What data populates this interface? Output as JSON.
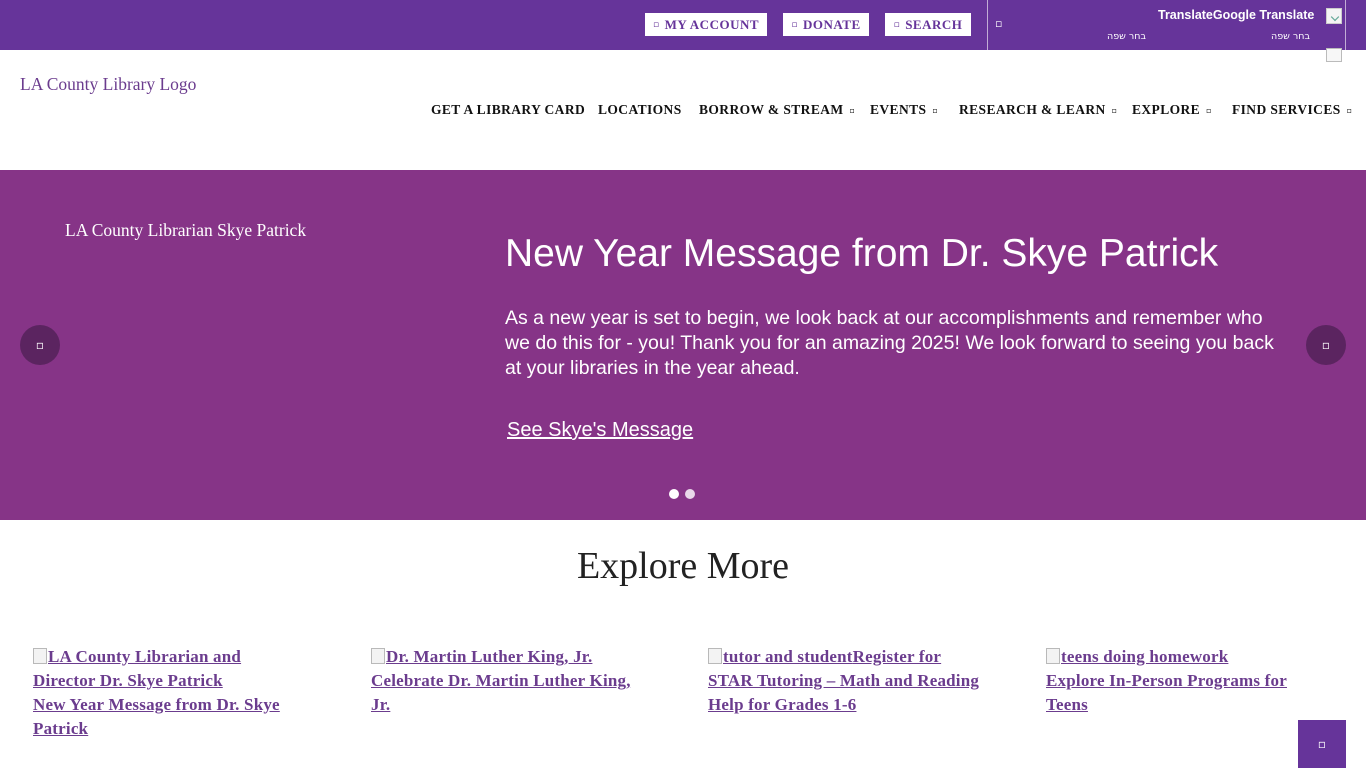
{
  "topbar": {
    "my_account": "MY ACCOUNT",
    "donate": "DONATE",
    "search": "SEARCH",
    "translate_label": "TranslateGoogle Translate",
    "lang_select_1": "בחר שפה",
    "lang_select_2": "בחר שפה",
    "bg_color": "#66349a"
  },
  "header": {
    "logo_alt": "LA County Library Logo",
    "nav": [
      {
        "label": "GET A LIBRARY CARD"
      },
      {
        "label": "LOCATIONS"
      },
      {
        "label": "BORROW & STREAM"
      },
      {
        "label": "EVENTS"
      },
      {
        "label": "RESEARCH & LEARN"
      },
      {
        "label": "EXPLORE"
      },
      {
        "label": "FIND SERVICES"
      }
    ]
  },
  "hero": {
    "image_alt": "LA County Librarian Skye Patrick",
    "title": "New Year Message from Dr. Skye Patrick",
    "body": "As a new year is set to begin, we look back at our accomplishments and remember who we do this for - you! Thank you for an amazing 2025! We look forward to seeing you back at your libraries in the year ahead.",
    "link": "See Skye's Message",
    "bg_color": "#863487",
    "slide_count": 2,
    "active_slide": 1
  },
  "explore": {
    "title": "Explore More",
    "cards": [
      {
        "img_alt": "LA County Librarian and Director Dr. Skye Patrick",
        "caption": "New Year Message from Dr. Skye Patrick"
      },
      {
        "img_alt": "Dr. Martin Luther King, Jr.",
        "caption": "Celebrate Dr. Martin Luther King, Jr."
      },
      {
        "img_alt": "tutor and student",
        "caption": "Register for STAR Tutoring – Math and Reading Help for Grades 1-6"
      },
      {
        "img_alt": "teens doing homework",
        "caption": "Explore In-Person Programs for Teens"
      }
    ]
  },
  "icons": {
    "account": "user-icon",
    "donate": "heart-icon",
    "search": "search-icon",
    "language": "globe-icon",
    "carousel_prev": "chevron-left-icon",
    "carousel_next": "chevron-right-icon",
    "back_to_top": "chevron-up-icon"
  }
}
